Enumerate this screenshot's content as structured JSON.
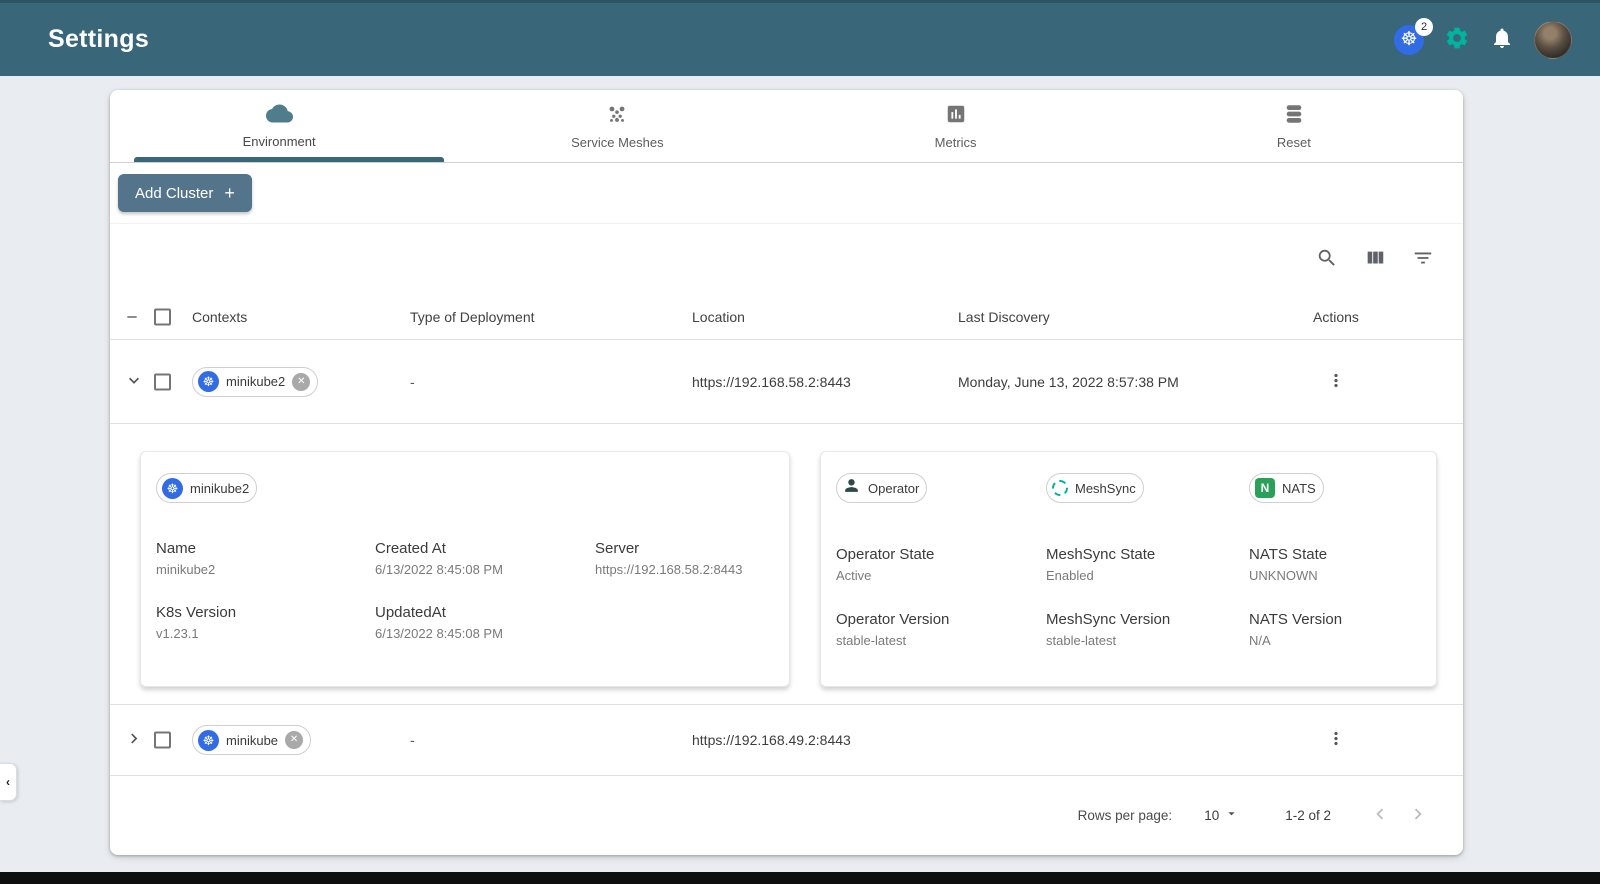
{
  "colors": {
    "header_bg": "#396679",
    "accent_green": "#00B39F",
    "kubernetes_blue": "#326CE5",
    "add_button": "#54748C",
    "nats_green": "#2BA058",
    "tab_indicator": "#396679"
  },
  "header": {
    "title": "Settings",
    "kubernetes_badge_count": "2",
    "icons": [
      "kubernetes-icon",
      "gear-icon",
      "bell-icon",
      "avatar"
    ]
  },
  "tabs": [
    {
      "label": "Environment",
      "icon": "cloud-icon",
      "active": true
    },
    {
      "label": "Service Meshes",
      "icon": "service-mesh-icon",
      "active": false
    },
    {
      "label": "Metrics",
      "icon": "bar-chart-icon",
      "active": false
    },
    {
      "label": "Reset",
      "icon": "database-icon",
      "active": false
    }
  ],
  "add_cluster": {
    "label": "Add Cluster",
    "plus": "+"
  },
  "table_tools": [
    "search-icon",
    "view-columns-icon",
    "filter-icon"
  ],
  "table": {
    "columns": [
      "Contexts",
      "Type of Deployment",
      "Location",
      "Last Discovery",
      "Actions"
    ],
    "rows": [
      {
        "context": "minikube2",
        "type_of_deployment": "-",
        "location": "https://192.168.58.2:8443",
        "last_discovery": "Monday, June 13, 2022 8:57:38 PM",
        "expanded": true
      },
      {
        "context": "minikube",
        "type_of_deployment": "-",
        "location": "https://192.168.49.2:8443",
        "expanded": false
      }
    ]
  },
  "expanded_panel": {
    "cluster_chip": "minikube2",
    "fields": [
      {
        "label": "Name",
        "value": "minikube2"
      },
      {
        "label": "Created At",
        "value": "6/13/2022 8:45:08 PM"
      },
      {
        "label": "Server",
        "value": "https://192.168.58.2:8443"
      },
      {
        "label": "K8s Version",
        "value": "v1.23.1"
      },
      {
        "label": "UpdatedAt",
        "value": "6/13/2022 8:45:08 PM"
      }
    ],
    "components": [
      {
        "chip": "Operator",
        "icon": "operator-icon",
        "state_label": "Operator State",
        "state": "Active",
        "version_label": "Operator Version",
        "version": "stable-latest"
      },
      {
        "chip": "MeshSync",
        "icon": "meshsync-icon",
        "state_label": "MeshSync State",
        "state": "Enabled",
        "version_label": "MeshSync Version",
        "version": "stable-latest"
      },
      {
        "chip": "NATS",
        "icon": "nats-icon",
        "state_label": "NATS State",
        "state": "UNKNOWN",
        "version_label": "NATS Version",
        "version": "N/A"
      }
    ]
  },
  "pagination": {
    "rows_per_page_label": "Rows per page:",
    "rows_per_page_value": "10",
    "range_text": "1-2 of 2"
  }
}
